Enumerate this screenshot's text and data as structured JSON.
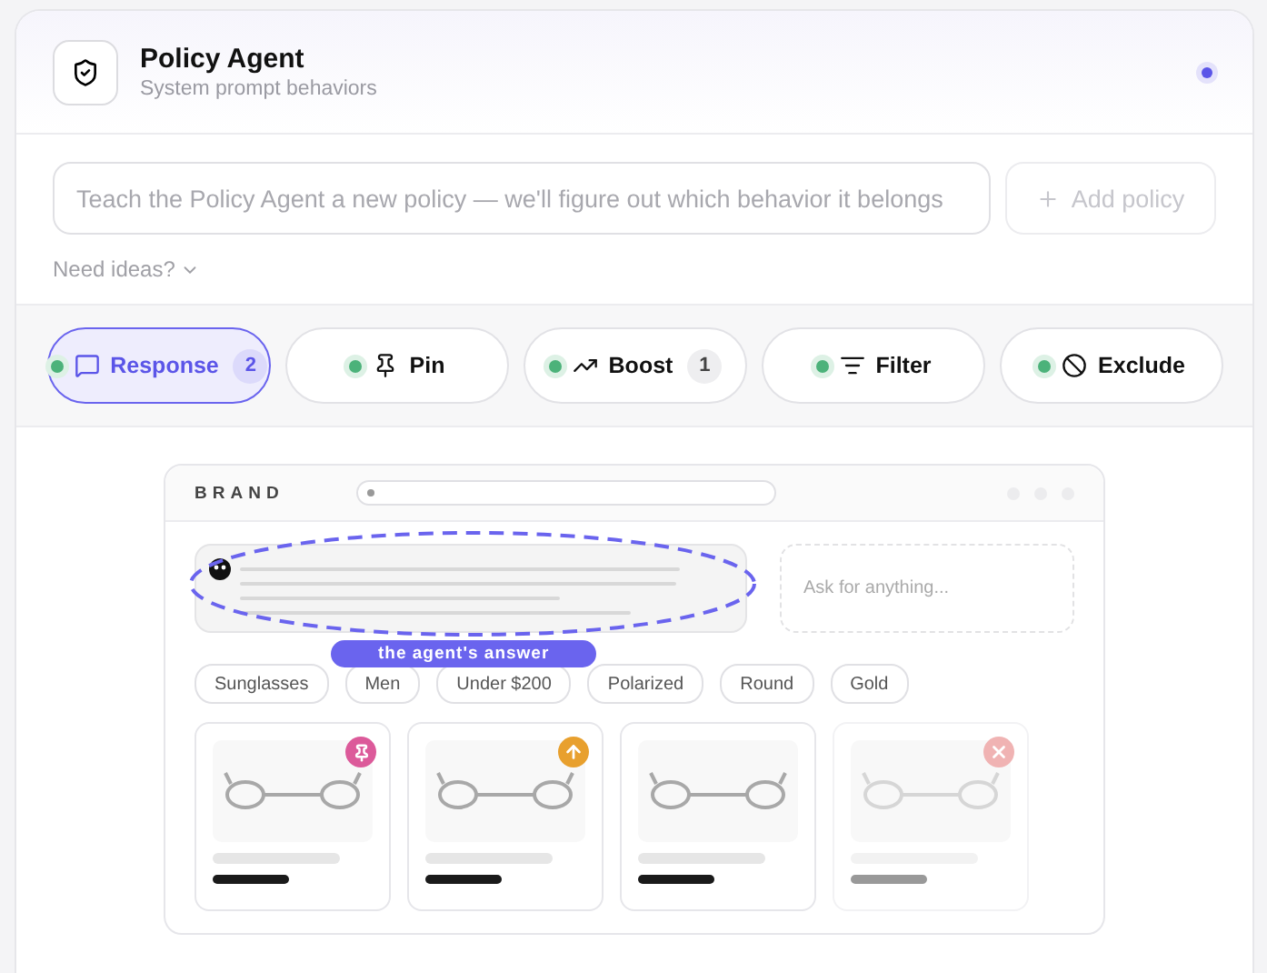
{
  "header": {
    "title": "Policy Agent",
    "subtitle": "System prompt behaviors"
  },
  "composer": {
    "placeholder": "Teach the Policy Agent a new policy — we'll figure out which behavior it belongs",
    "button": "Add policy",
    "button_disabled": true,
    "ideas": "Need ideas?"
  },
  "tabs": [
    {
      "kind": "response",
      "label": "Response",
      "count": "2",
      "selected": true
    },
    {
      "kind": "pin",
      "label": "Pin",
      "selected": false
    },
    {
      "kind": "boost",
      "label": "Boost",
      "count": "1",
      "selected": false
    },
    {
      "kind": "filter",
      "label": "Filter",
      "selected": false
    },
    {
      "kind": "exclude",
      "label": "Exclude",
      "selected": false
    }
  ],
  "preview": {
    "brand": "BRAND",
    "ask_placeholder": "Ask for anything...",
    "callout": "the agent's answer",
    "chips": [
      "Sunglasses",
      "Men",
      "Under $200",
      "Polarized",
      "Round",
      "Gold"
    ],
    "products": [
      {
        "kind": "pin"
      },
      {
        "kind": "boost"
      },
      {
        "kind": "plain"
      },
      {
        "kind": "excluded"
      }
    ]
  }
}
